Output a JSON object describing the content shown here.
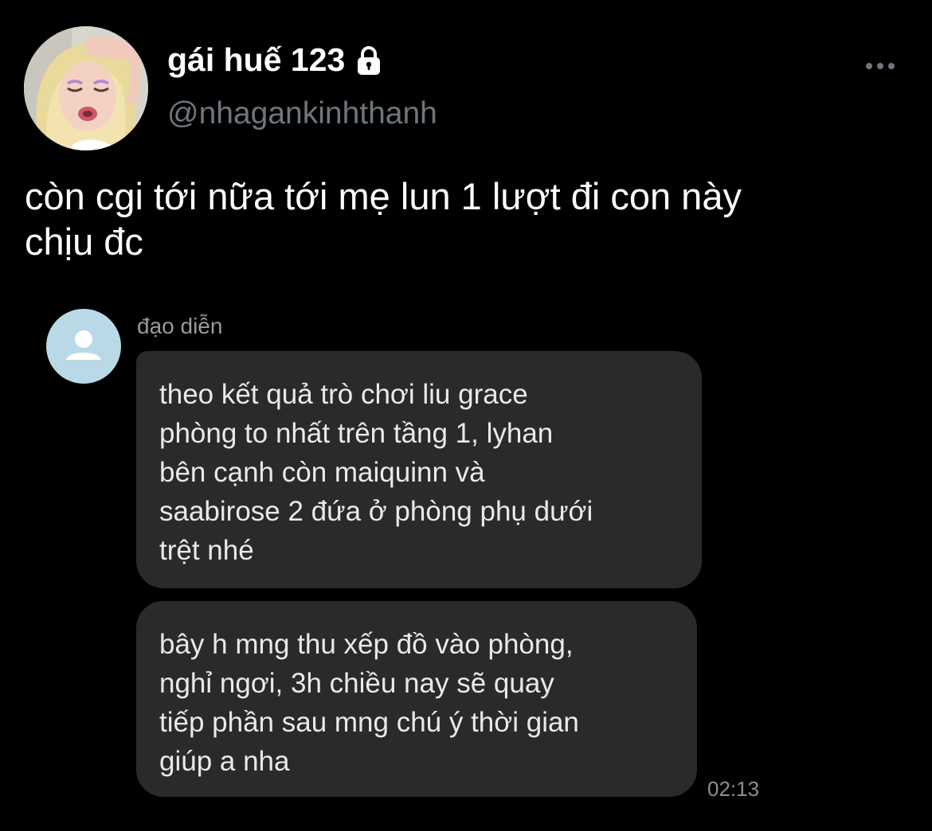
{
  "profile": {
    "display_name": "gái huế 123",
    "handle": "@nhagankinhthanh",
    "lock_icon": "lock-icon",
    "more_icon": "more-horizontal-icon"
  },
  "tweet": {
    "text_lines": [
      "còn cgi tới nữa tới mẹ lun 1 lượt đi con này",
      "chịu đc"
    ]
  },
  "screenshot": {
    "sender": "đạo diễn",
    "messages": [
      {
        "lines": [
          "theo kết quả trò chơi liu grace",
          "phòng to nhất trên tầng 1, lyhan",
          "bên cạnh còn maiquinn và",
          "saabirose 2 đứa ở phòng phụ dưới",
          "trệt nhé"
        ]
      },
      {
        "lines": [
          "bây h mng thu xếp đồ vào phòng,",
          "nghỉ ngơi, 3h chiều nay sẽ quay",
          "tiếp phần sau mng chú ý thời gian",
          "giúp a nha"
        ]
      }
    ],
    "timestamp": "02:13"
  },
  "colors": {
    "background": "#000000",
    "handle_gray": "#6e767d",
    "bubble": "#2a2a2c",
    "default_avatar": "#b9d9e6"
  }
}
